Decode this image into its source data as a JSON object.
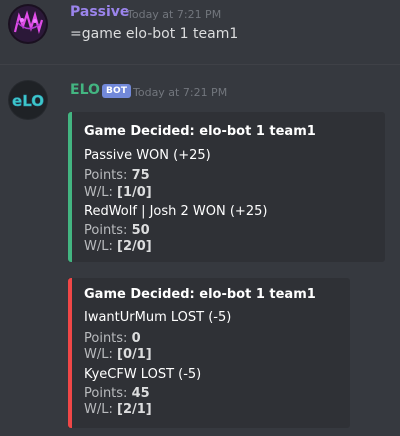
{
  "messages": [
    {
      "author": "Passive",
      "timestamp": "Today at 7:21 PM",
      "text": "=game elo-bot 1 team1",
      "author_color": "#9b84ec"
    },
    {
      "author": "ELO",
      "badge": "BOT",
      "timestamp": "Today at 7:21 PM",
      "author_color": "#43b581",
      "embeds": [
        {
          "accent": "#43b581",
          "title": "Game Decided: elo-bot 1 team1",
          "players": [
            {
              "result": "Passive WON (+25)",
              "points_label": "Points:",
              "points": "75",
              "wl_label": "W/L:",
              "wl": "[1/0]"
            },
            {
              "result": "RedWolf | Josh 2 WON (+25)",
              "points_label": "Points:",
              "points": "50",
              "wl_label": "W/L:",
              "wl": "[2/0]"
            }
          ]
        },
        {
          "accent": "#f04747",
          "title": "Game Decided: elo-bot 1 team1",
          "players": [
            {
              "result": "IwantUrMum LOST (-5)",
              "points_label": "Points:",
              "points": "0",
              "wl_label": "W/L:",
              "wl": "[0/1]"
            },
            {
              "result": "KyeCFW LOST (-5)",
              "points_label": "Points:",
              "points": "45",
              "wl_label": "W/L:",
              "wl": "[2/1]"
            }
          ]
        }
      ]
    }
  ],
  "icons": {
    "passive_avatar": "passive-avatar",
    "elo_avatar": "elo-bot-avatar"
  }
}
